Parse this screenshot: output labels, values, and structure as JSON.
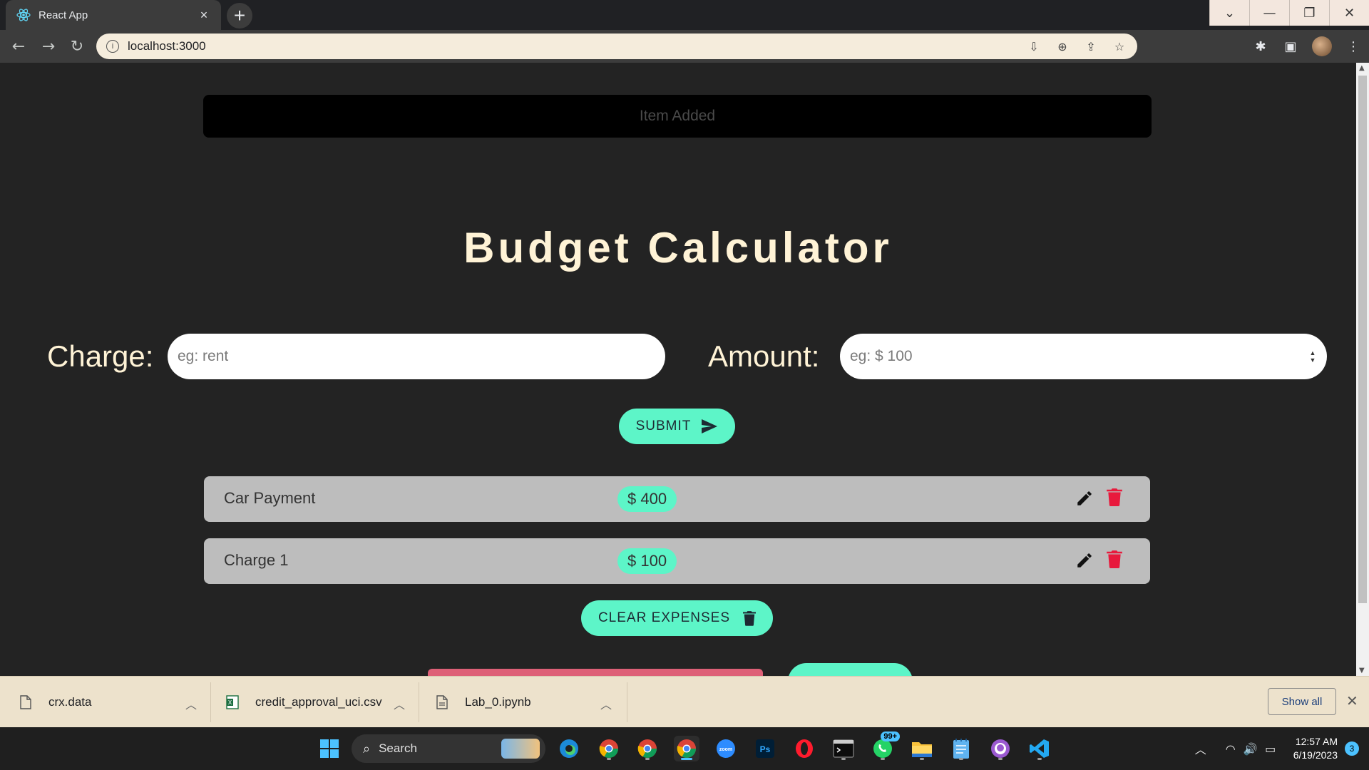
{
  "browser": {
    "tab_title": "React App",
    "url": "localhost:3000"
  },
  "app": {
    "alert": "Item Added",
    "title": "Budget Calculator",
    "charge_label": "Charge:",
    "charge_placeholder": "eg: rent",
    "amount_label": "Amount:",
    "amount_placeholder": "eg: $ 100",
    "submit_label": "SUBMIT",
    "clear_label": "CLEAR EXPENSES",
    "expenses": [
      {
        "name": "Car Payment",
        "amount": "$ 400"
      },
      {
        "name": "Charge 1",
        "amount": "$ 100"
      }
    ]
  },
  "downloads": {
    "items": [
      {
        "name": "crx.data"
      },
      {
        "name": "credit_approval_uci.csv"
      },
      {
        "name": "Lab_0.ipynb"
      }
    ],
    "show_all": "Show all"
  },
  "taskbar": {
    "search_label": "Search",
    "whatsapp_badge": "99+",
    "time": "12:57 AM",
    "date": "6/19/2023",
    "notifications": "3"
  },
  "colors": {
    "accent": "#5df5c8",
    "title": "#fff3d6",
    "background": "#232323",
    "delete": "#e8193c"
  }
}
